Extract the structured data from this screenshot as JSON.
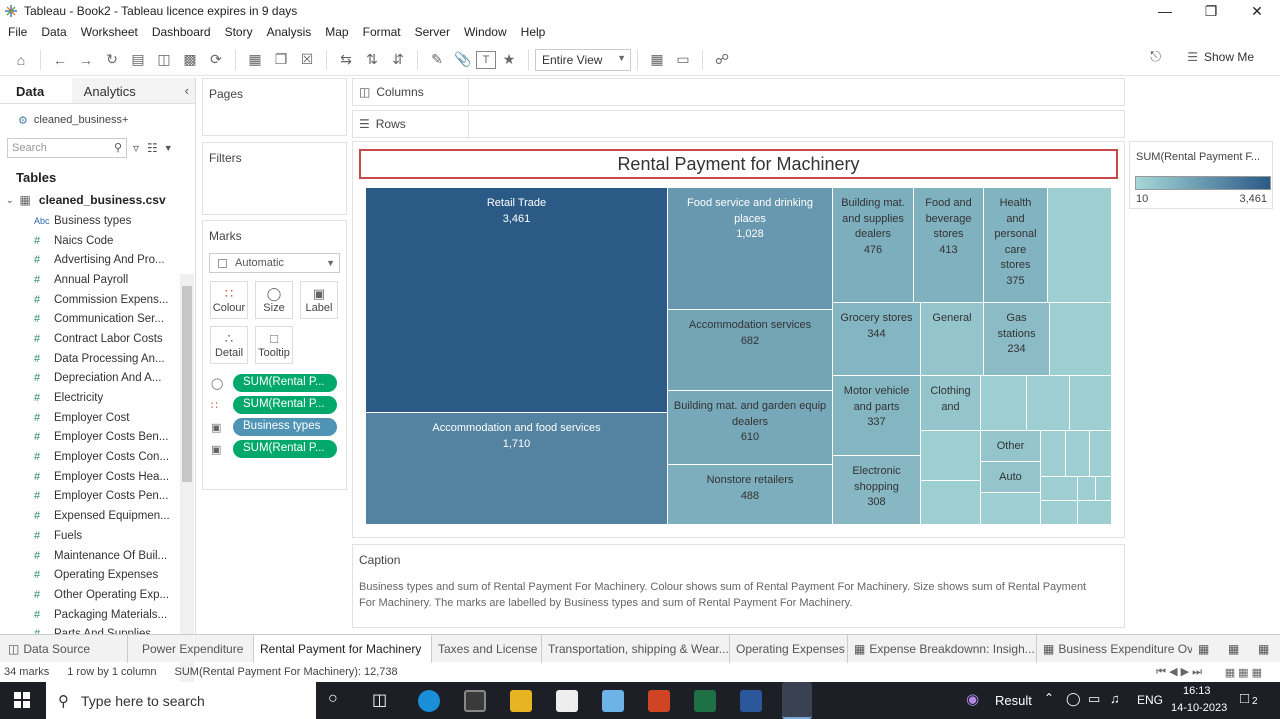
{
  "window": {
    "title": "Tableau - Book2 - Tableau licence expires in 9 days"
  },
  "menu": [
    "File",
    "Data",
    "Worksheet",
    "Dashboard",
    "Story",
    "Analysis",
    "Map",
    "Format",
    "Server",
    "Window",
    "Help"
  ],
  "toolbar": {
    "view_select": "Entire View",
    "show_me": "Show Me"
  },
  "left": {
    "tab_data": "Data",
    "tab_analytics": "Analytics",
    "datasource": "cleaned_business+",
    "search_placeholder": "Search",
    "tables_heading": "Tables",
    "table_name": "cleaned_business.csv",
    "fields": [
      {
        "icon": "Abc",
        "label": "Business types"
      },
      {
        "icon": "#",
        "label": "Naics Code"
      },
      {
        "icon": "#",
        "label": "Advertising And Pro..."
      },
      {
        "icon": "#",
        "label": "Annual Payroll"
      },
      {
        "icon": "#",
        "label": "Commission Expens..."
      },
      {
        "icon": "#",
        "label": "Communication Ser..."
      },
      {
        "icon": "#",
        "label": "Contract Labor Costs"
      },
      {
        "icon": "#",
        "label": "Data Processing An..."
      },
      {
        "icon": "#",
        "label": "Depreciation And A..."
      },
      {
        "icon": "#",
        "label": "Electricity"
      },
      {
        "icon": "#",
        "label": "Employer Cost"
      },
      {
        "icon": "#",
        "label": "Employer Costs Ben..."
      },
      {
        "icon": "#",
        "label": "Employer Costs Con..."
      },
      {
        "icon": "#",
        "label": "Employer Costs Hea..."
      },
      {
        "icon": "#",
        "label": "Employer Costs Pen..."
      },
      {
        "icon": "#",
        "label": "Expensed Equipmen..."
      },
      {
        "icon": "#",
        "label": "Fuels"
      },
      {
        "icon": "#",
        "label": "Maintenance Of Buil..."
      },
      {
        "icon": "#",
        "label": "Operating Expenses"
      },
      {
        "icon": "#",
        "label": "Other Operating Exp..."
      },
      {
        "icon": "#",
        "label": "Packaging Materials..."
      },
      {
        "icon": "#",
        "label": "Parts And Supplies"
      }
    ]
  },
  "shelves": {
    "pages": "Pages",
    "filters": "Filters",
    "marks": "Marks",
    "mark_type": "Automatic",
    "mark_buttons": [
      "Colour",
      "Size",
      "Label",
      "Detail",
      "Tooltip"
    ],
    "mark_pills": [
      {
        "label": "SUM(Rental P...",
        "kind": "green"
      },
      {
        "label": "SUM(Rental P...",
        "kind": "green"
      },
      {
        "label": "Business types",
        "kind": "blue"
      },
      {
        "label": "SUM(Rental P...",
        "kind": "green"
      }
    ],
    "columns": "Columns",
    "rows": "Rows"
  },
  "chart_data": {
    "type": "treemap",
    "title": "Rental Payment for Machinery",
    "color_min": 10,
    "color_max": 3461,
    "items": [
      {
        "name": "Retail Trade",
        "value": 3461
      },
      {
        "name": "Accommodation and food services",
        "value": 1710
      },
      {
        "name": "Food service and drinking places",
        "value": 1028
      },
      {
        "name": "Accommodation services",
        "value": 682
      },
      {
        "name": "Building mat. and garden equip dealers",
        "value": 610
      },
      {
        "name": "Nonstore retailers",
        "value": 488
      },
      {
        "name": "Building mat. and supplies dealers",
        "value": 476
      },
      {
        "name": "Food and beverage stores",
        "value": 413
      },
      {
        "name": "Health and personal care stores",
        "value": 375
      },
      {
        "name": "Grocery stores",
        "value": 344
      },
      {
        "name": "General",
        "value": null
      },
      {
        "name": "Gas stations",
        "value": 234
      },
      {
        "name": "Motor vehicle and parts",
        "value": 337
      },
      {
        "name": "Clothing and",
        "value": null
      },
      {
        "name": "Electronic shopping",
        "value": 308
      },
      {
        "name": "Other",
        "value": null
      },
      {
        "name": "Auto",
        "value": null
      }
    ]
  },
  "legend": {
    "title": "SUM(Rental Payment F...",
    "min": "10",
    "max": "3,461"
  },
  "caption": {
    "heading": "Caption",
    "text": "Business types and sum of Rental Payment For Machinery.  Colour shows sum of Rental Payment For Machinery.  Size shows sum of Rental Payment For Machinery.  The marks are labelled by Business types and sum of Rental Payment For Machinery."
  },
  "sheet_tabs": [
    "Data Source",
    "Power Expenditure",
    "Rental Payment for Machinery",
    "Taxes and License",
    "Transportation, shipping & Wear...",
    "Operating Expenses",
    "Expense Breakdownn: Insigh...",
    "Business Expenditure Ov"
  ],
  "active_sheet": "Rental Payment for Machinery",
  "status": {
    "marks": "34 marks",
    "rows": "1 row by 1 column",
    "sum": "SUM(Rental Payment For Machinery): 12,738"
  },
  "taskbar": {
    "search": "Type here to search",
    "weather": "Result",
    "lang": "ENG",
    "time": "16:13",
    "date": "14-10-2023",
    "notif": "2"
  }
}
